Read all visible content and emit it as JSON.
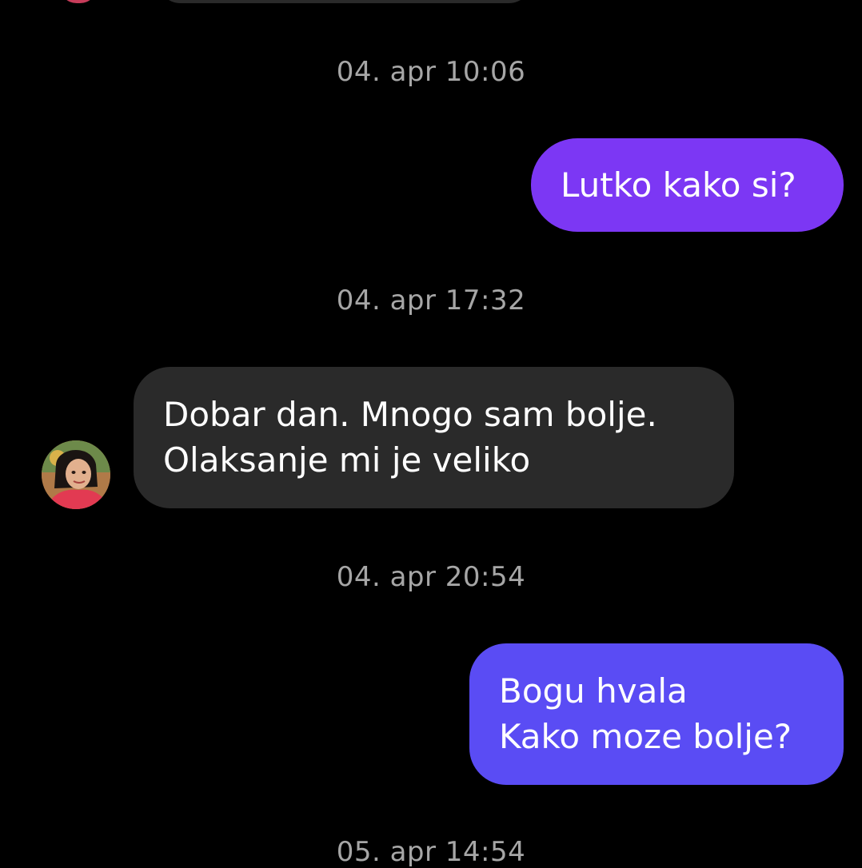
{
  "conversation": {
    "messages": [
      {
        "timestamp": "04. apr 10:06",
        "direction": "outgoing",
        "text": "Lutko kako si?",
        "color": "#7c37f4"
      },
      {
        "timestamp": "04. apr 17:32",
        "direction": "incoming",
        "text": "Dobar dan. Mnogo sam bolje.\nOlaksanje mi je veliko",
        "color": "#2a2a2a"
      },
      {
        "timestamp": "04. apr 20:54",
        "direction": "outgoing",
        "text": "Bogu hvala\nKako moze bolje?",
        "color": "#5a4cf4"
      }
    ],
    "next_timestamp_partial": "05. apr 14:54"
  },
  "theme": {
    "background": "#000000",
    "timestamp_color": "#a6a6a6",
    "incoming_bubble": "#2a2a2a"
  },
  "icons": {
    "contact_avatar": "contact-avatar-photo"
  }
}
